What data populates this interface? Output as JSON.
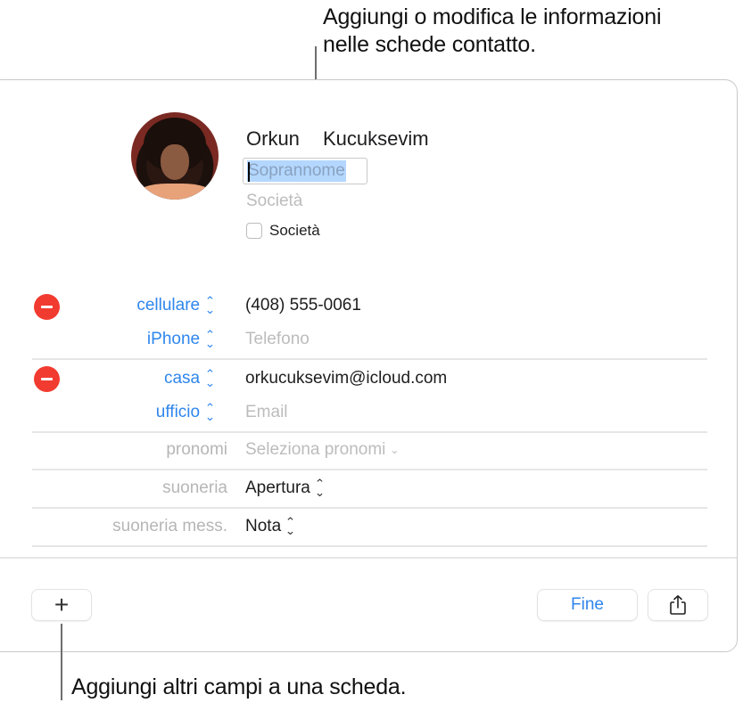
{
  "callouts": {
    "top_line1": "Aggiungi o modifica le informazioni",
    "top_line2": "nelle schede contatto.",
    "bottom": "Aggiungi altri campi a una scheda."
  },
  "contact": {
    "first_name": "Orkun",
    "last_name": "Kucuksevim",
    "nickname_placeholder": "Soprannome",
    "company_placeholder": "Società",
    "company_checkbox_label": "Società",
    "company_checkbox_checked": false
  },
  "fields": {
    "phone": {
      "label": "cellulare",
      "value": "(408) 555-0061"
    },
    "phone_new": {
      "label": "iPhone",
      "placeholder": "Telefono"
    },
    "email": {
      "label": "casa",
      "value": "orkucuksevim@icloud.com"
    },
    "email_new": {
      "label": "ufficio",
      "placeholder": "Email"
    },
    "pronouns": {
      "label": "pronomi",
      "placeholder": "Seleziona pronomi"
    },
    "ringtone": {
      "label": "suoneria",
      "value": "Apertura"
    },
    "text_tone": {
      "label": "suoneria mess.",
      "value": "Nota"
    }
  },
  "toolbar": {
    "add_label": "+",
    "done_label": "Fine",
    "share_icon": "share-icon"
  },
  "colors": {
    "accent": "#2f86ec",
    "delete": "#f23b30",
    "selection": "#b3d7ff"
  }
}
